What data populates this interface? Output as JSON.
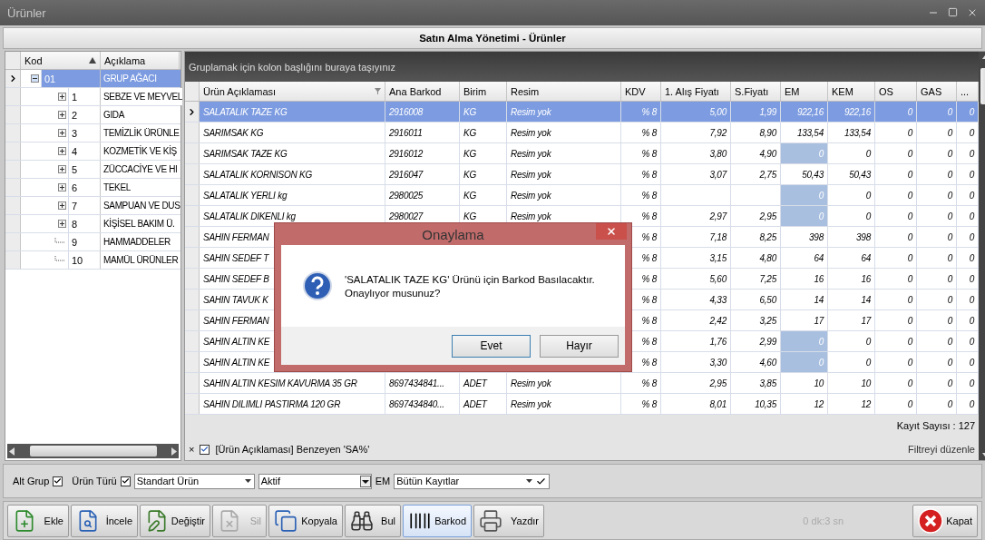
{
  "window": {
    "title": "Ürünler",
    "header": "Satın Alma Yönetimi - Ürünler"
  },
  "tree": {
    "columns": [
      {
        "label": "Kod",
        "sorted": true
      },
      {
        "label": "Açıklama",
        "sorted": false
      }
    ],
    "nodes": [
      {
        "code": "01",
        "name": "GRUP AĞACI",
        "kind": "folder",
        "expanded": true,
        "selected": true,
        "children": [
          {
            "code": "1",
            "name": "SEBZE VE MEYVEL",
            "kind": "folder",
            "expanded": false,
            "selected": false
          },
          {
            "code": "2",
            "name": "GIDA",
            "kind": "folder",
            "expanded": false,
            "selected": false
          },
          {
            "code": "3",
            "name": "TEMİZLİK ÜRÜNLE",
            "kind": "folder",
            "expanded": false,
            "selected": false
          },
          {
            "code": "4",
            "name": "KOZMETİK VE KİŞ",
            "kind": "folder",
            "expanded": false,
            "selected": false
          },
          {
            "code": "5",
            "name": "ZÜCCACİYE VE HI",
            "kind": "folder",
            "expanded": false,
            "selected": false
          },
          {
            "code": "6",
            "name": "TEKEL",
            "kind": "folder",
            "expanded": false,
            "selected": false
          },
          {
            "code": "7",
            "name": "SAMPUAN VE DUS",
            "kind": "folder",
            "expanded": false,
            "selected": false
          },
          {
            "code": "8",
            "name": "KİŞİSEL BAKIM Ü.",
            "kind": "folder",
            "expanded": false,
            "selected": false
          },
          {
            "code": "9",
            "name": "HAMMADDELER",
            "kind": "leaf",
            "selected": false
          },
          {
            "code": "10",
            "name": "MAMÜL ÜRÜNLER",
            "kind": "leaf",
            "selected": false
          }
        ]
      }
    ]
  },
  "grid": {
    "group_hint": "Gruplamak için kolon başlığını buraya taşıyınız",
    "columns": [
      {
        "label": "Ürün Açıklaması",
        "kind": "text",
        "filtered": true
      },
      {
        "label": "Ana Barkod",
        "kind": "text",
        "filtered": false
      },
      {
        "label": "Birim",
        "kind": "text",
        "filtered": false
      },
      {
        "label": "Resim",
        "kind": "text",
        "filtered": false
      },
      {
        "label": "KDV",
        "kind": "number",
        "filtered": false
      },
      {
        "label": "1. Alış Fiyatı",
        "kind": "number",
        "filtered": false
      },
      {
        "label": "S.Fiyatı",
        "kind": "number",
        "filtered": false
      },
      {
        "label": "EM",
        "kind": "number",
        "filtered": false
      },
      {
        "label": "KEM",
        "kind": "number",
        "filtered": false
      },
      {
        "label": "OS",
        "kind": "number",
        "filtered": false
      },
      {
        "label": "GAS",
        "kind": "number",
        "filtered": false
      },
      {
        "label": "...",
        "kind": "number",
        "filtered": false
      }
    ],
    "rows": [
      {
        "selected": true,
        "em_highlight": false,
        "cells": [
          "SALATALIK TAZE KG",
          "2916008",
          "KG",
          "Resim yok",
          "% 8",
          "5,00",
          "1,99",
          "922,16",
          "922,16",
          "0",
          "0",
          "0"
        ]
      },
      {
        "selected": false,
        "em_highlight": false,
        "cells": [
          "SARIMSAK KG",
          "2916011",
          "KG",
          "Resim yok",
          "% 8",
          "7,92",
          "8,90",
          "133,54",
          "133,54",
          "0",
          "0",
          "0"
        ]
      },
      {
        "selected": false,
        "em_highlight": true,
        "cells": [
          "SARIMSAK TAZE KG",
          "2916012",
          "KG",
          "Resim yok",
          "% 8",
          "3,80",
          "4,90",
          "0",
          "0",
          "0",
          "0",
          "0"
        ]
      },
      {
        "selected": false,
        "em_highlight": false,
        "cells": [
          "SALATALIK KORNISON  KG",
          "2916047",
          "KG",
          "Resim yok",
          "% 8",
          "3,07",
          "2,75",
          "50,43",
          "50,43",
          "0",
          "0",
          "0"
        ]
      },
      {
        "selected": false,
        "em_highlight": true,
        "cells": [
          "SALATALIK YERLI kg",
          "2980025",
          "KG",
          "Resim yok",
          "% 8",
          null,
          null,
          "0",
          "0",
          "0",
          "0",
          "0"
        ]
      },
      {
        "selected": false,
        "em_highlight": true,
        "cells": [
          "SALATALIK DIKENLI kg",
          "2980027",
          "KG",
          "Resim yok",
          "% 8",
          "2,97",
          "2,95",
          "0",
          "0",
          "0",
          "0",
          "0"
        ]
      },
      {
        "selected": false,
        "em_highlight": false,
        "cells": [
          "SAHIN FERMAN",
          null,
          null,
          null,
          "% 8",
          "7,18",
          "8,25",
          "398",
          "398",
          "0",
          "0",
          "0"
        ]
      },
      {
        "selected": false,
        "em_highlight": false,
        "cells": [
          "SAHIN SEDEF T",
          null,
          null,
          null,
          "% 8",
          "3,15",
          "4,80",
          "64",
          "64",
          "0",
          "0",
          "0"
        ]
      },
      {
        "selected": false,
        "em_highlight": false,
        "cells": [
          "SAHIN SEDEF  B",
          null,
          null,
          null,
          "% 8",
          "5,60",
          "7,25",
          "16",
          "16",
          "0",
          "0",
          "0"
        ]
      },
      {
        "selected": false,
        "em_highlight": false,
        "cells": [
          "SAHIN TAVUK K",
          null,
          null,
          null,
          "% 8",
          "4,33",
          "6,50",
          "14",
          "14",
          "0",
          "0",
          "0"
        ]
      },
      {
        "selected": false,
        "em_highlight": false,
        "cells": [
          "SAHIN FERMAN",
          null,
          null,
          null,
          "% 8",
          "2,42",
          "3,25",
          "17",
          "17",
          "0",
          "0",
          "0"
        ]
      },
      {
        "selected": false,
        "em_highlight": true,
        "cells": [
          "SAHIN ALTIN KE",
          null,
          null,
          null,
          "% 8",
          "1,76",
          "2,99",
          "0",
          "0",
          "0",
          "0",
          "0"
        ]
      },
      {
        "selected": false,
        "em_highlight": true,
        "cells": [
          "SAHIN ALTIN KE",
          null,
          null,
          null,
          "% 8",
          "3,30",
          "4,60",
          "0",
          "0",
          "0",
          "0",
          "0"
        ]
      },
      {
        "selected": false,
        "em_highlight": false,
        "cells": [
          "SAHIN ALTIN KESIM KAVURMA 35 GR",
          "8697434841...",
          "ADET",
          "Resim yok",
          "% 8",
          "2,95",
          "3,85",
          "10",
          "10",
          "0",
          "0",
          "0"
        ]
      },
      {
        "selected": false,
        "em_highlight": false,
        "cells": [
          "SAHIN DILIMLI PASTIRMA 120 GR",
          "8697434840...",
          "ADET",
          "Resim yok",
          "% 8",
          "8,01",
          "10,35",
          "12",
          "12",
          "0",
          "0",
          "0"
        ]
      }
    ],
    "record_count": "Kayıt Sayısı : 127",
    "filter": {
      "close": "×",
      "checked": true,
      "text": "[Ürün Açıklaması] Benzeyen 'SA%'",
      "edit_link": "Filtreyi düzenle"
    }
  },
  "filters": {
    "alt_grup": {
      "label": "Alt Grup",
      "checked": true
    },
    "urun_turu": {
      "label": "Ürün Türü",
      "checked": true
    },
    "type_combo": "Standart Ürün",
    "status_combo": "Aktif",
    "em_label": "EM",
    "em_combo": "Bütün Kayıtlar"
  },
  "toolbar": [
    {
      "kind": "add",
      "label": "Ekle",
      "disabled": false,
      "selected": false
    },
    {
      "kind": "view",
      "label": "İncele",
      "disabled": false,
      "selected": false
    },
    {
      "kind": "edit",
      "label": "Değiştir",
      "disabled": false,
      "selected": false
    },
    {
      "kind": "delete",
      "label": "Sil",
      "disabled": true,
      "selected": false
    },
    {
      "kind": "copy",
      "label": "Kopyala",
      "disabled": false,
      "selected": false
    },
    {
      "kind": "find",
      "label": "Bul",
      "disabled": false,
      "selected": false
    },
    {
      "kind": "barcode",
      "label": "Barkod",
      "disabled": false,
      "selected": true
    },
    {
      "kind": "print",
      "label": "Yazdır",
      "disabled": false,
      "selected": false
    }
  ],
  "timer": "0 dk:3 sn",
  "close_button": "Kapat",
  "dialog": {
    "title": "Onaylama",
    "message_lines": [
      "'SALATALIK TAZE KG' Ürünü için Barkod Basılacaktır.",
      "Onaylıyor musunuz?"
    ],
    "buttons": [
      {
        "label": "Evet",
        "selected": true
      },
      {
        "label": "Hayır",
        "selected": false
      }
    ]
  }
}
